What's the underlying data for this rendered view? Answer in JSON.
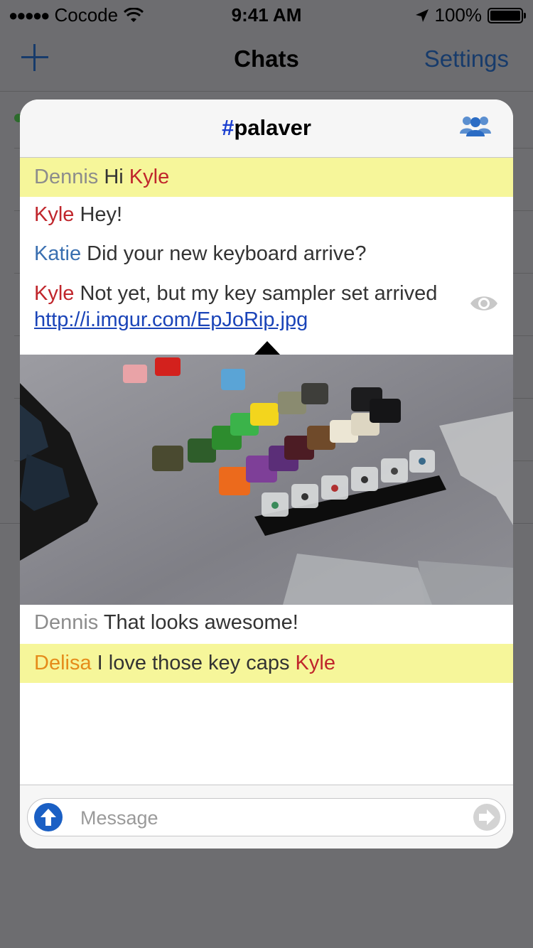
{
  "status_bar": {
    "carrier": "Cocode",
    "time": "9:41 AM",
    "battery": "100%"
  },
  "nav": {
    "title": "Chats",
    "settings_label": "Settings",
    "add_icon": "plus-icon"
  },
  "popup": {
    "channel_hash": "#",
    "channel_name": "palaver",
    "users_icon": "users-icon",
    "messages": [
      {
        "nick": "Dennis",
        "text": "Hi",
        "mention": "Kyle",
        "highlighted": true
      },
      {
        "nick": "Kyle",
        "text": "Hey!"
      },
      {
        "nick": "Katie",
        "text": "Did your new keyboard arrive?"
      },
      {
        "nick": "Kyle",
        "text": "Not yet, but my key sampler set arrived",
        "link": "http://i.imgur.com/EpJoRip.jpg"
      },
      {
        "nick": "Dennis",
        "text": "That looks awesome!"
      },
      {
        "nick": "Delisa",
        "text": "I love those key caps",
        "mention": "Kyle",
        "highlighted": true
      }
    ],
    "composer": {
      "placeholder": "Message",
      "upload_icon": "upload-arrow-icon",
      "send_icon": "send-arrow-icon"
    }
  },
  "colors": {
    "highlight": "#f6f69a",
    "nick_dennis": "#8c8c8c",
    "nick_kyle": "#c0262c",
    "nick_katie": "#3a6fb0",
    "nick_delisa": "#e58b1a",
    "link": "#1a44b8",
    "accent": "#1a5fc4"
  }
}
